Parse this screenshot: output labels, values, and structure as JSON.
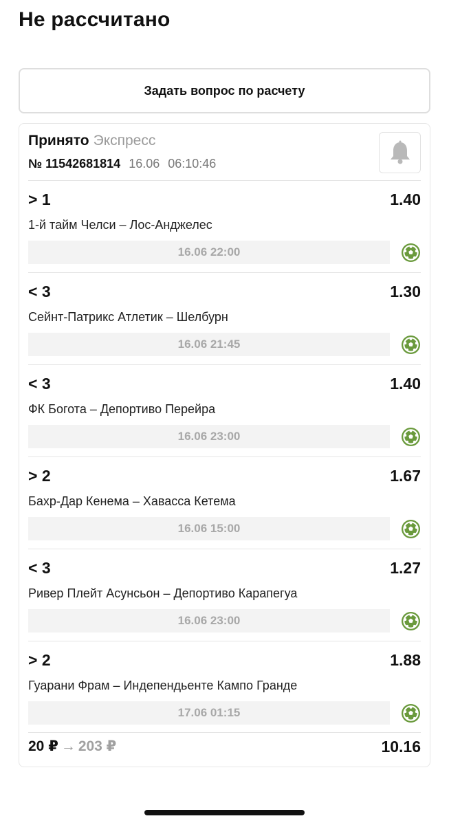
{
  "page": {
    "title": "Не рассчитано"
  },
  "ask_button": {
    "label": "Задать вопрос по расчету"
  },
  "bet": {
    "status": "Принято",
    "type": "Экспресс",
    "number": "№ 11542681814",
    "date": "16.06",
    "time": "06:10:46",
    "bell_icon": "bell-icon"
  },
  "items": [
    {
      "outcome": "> 1",
      "odds": "1.40",
      "match": "1-й тайм Челси – Лос-Анджелес",
      "start": "16.06 22:00",
      "sport_icon": "soccer-ball-icon"
    },
    {
      "outcome": "< 3",
      "odds": "1.30",
      "match": "Сейнт-Патрикс Атлетик – Шелбурн",
      "start": "16.06 21:45",
      "sport_icon": "soccer-ball-icon"
    },
    {
      "outcome": "< 3",
      "odds": "1.40",
      "match": "ФК Богота – Депортиво Перейра",
      "start": "16.06 23:00",
      "sport_icon": "soccer-ball-icon"
    },
    {
      "outcome": "> 2",
      "odds": "1.67",
      "match": "Бахр-Дар Кенема – Хавасса Кетема",
      "start": "16.06 15:00",
      "sport_icon": "soccer-ball-icon"
    },
    {
      "outcome": "< 3",
      "odds": "1.27",
      "match": "Ривер Плейт Асунсьон – Депортиво Карапегуа",
      "start": "16.06 23:00",
      "sport_icon": "soccer-ball-icon"
    },
    {
      "outcome": "> 2",
      "odds": "1.88",
      "match": "Гуарани Фрам – Индепендьенте Кампо Гранде",
      "start": "17.06 01:15",
      "sport_icon": "soccer-ball-icon"
    }
  ],
  "footer": {
    "stake": "20 ₽",
    "arrow": "→",
    "payout": "203 ₽",
    "total_odds": "10.16"
  },
  "colors": {
    "sport_icon": "#6a9a3c",
    "muted_text": "#a0a0a0",
    "time_bar_bg": "#f3f3f3"
  }
}
